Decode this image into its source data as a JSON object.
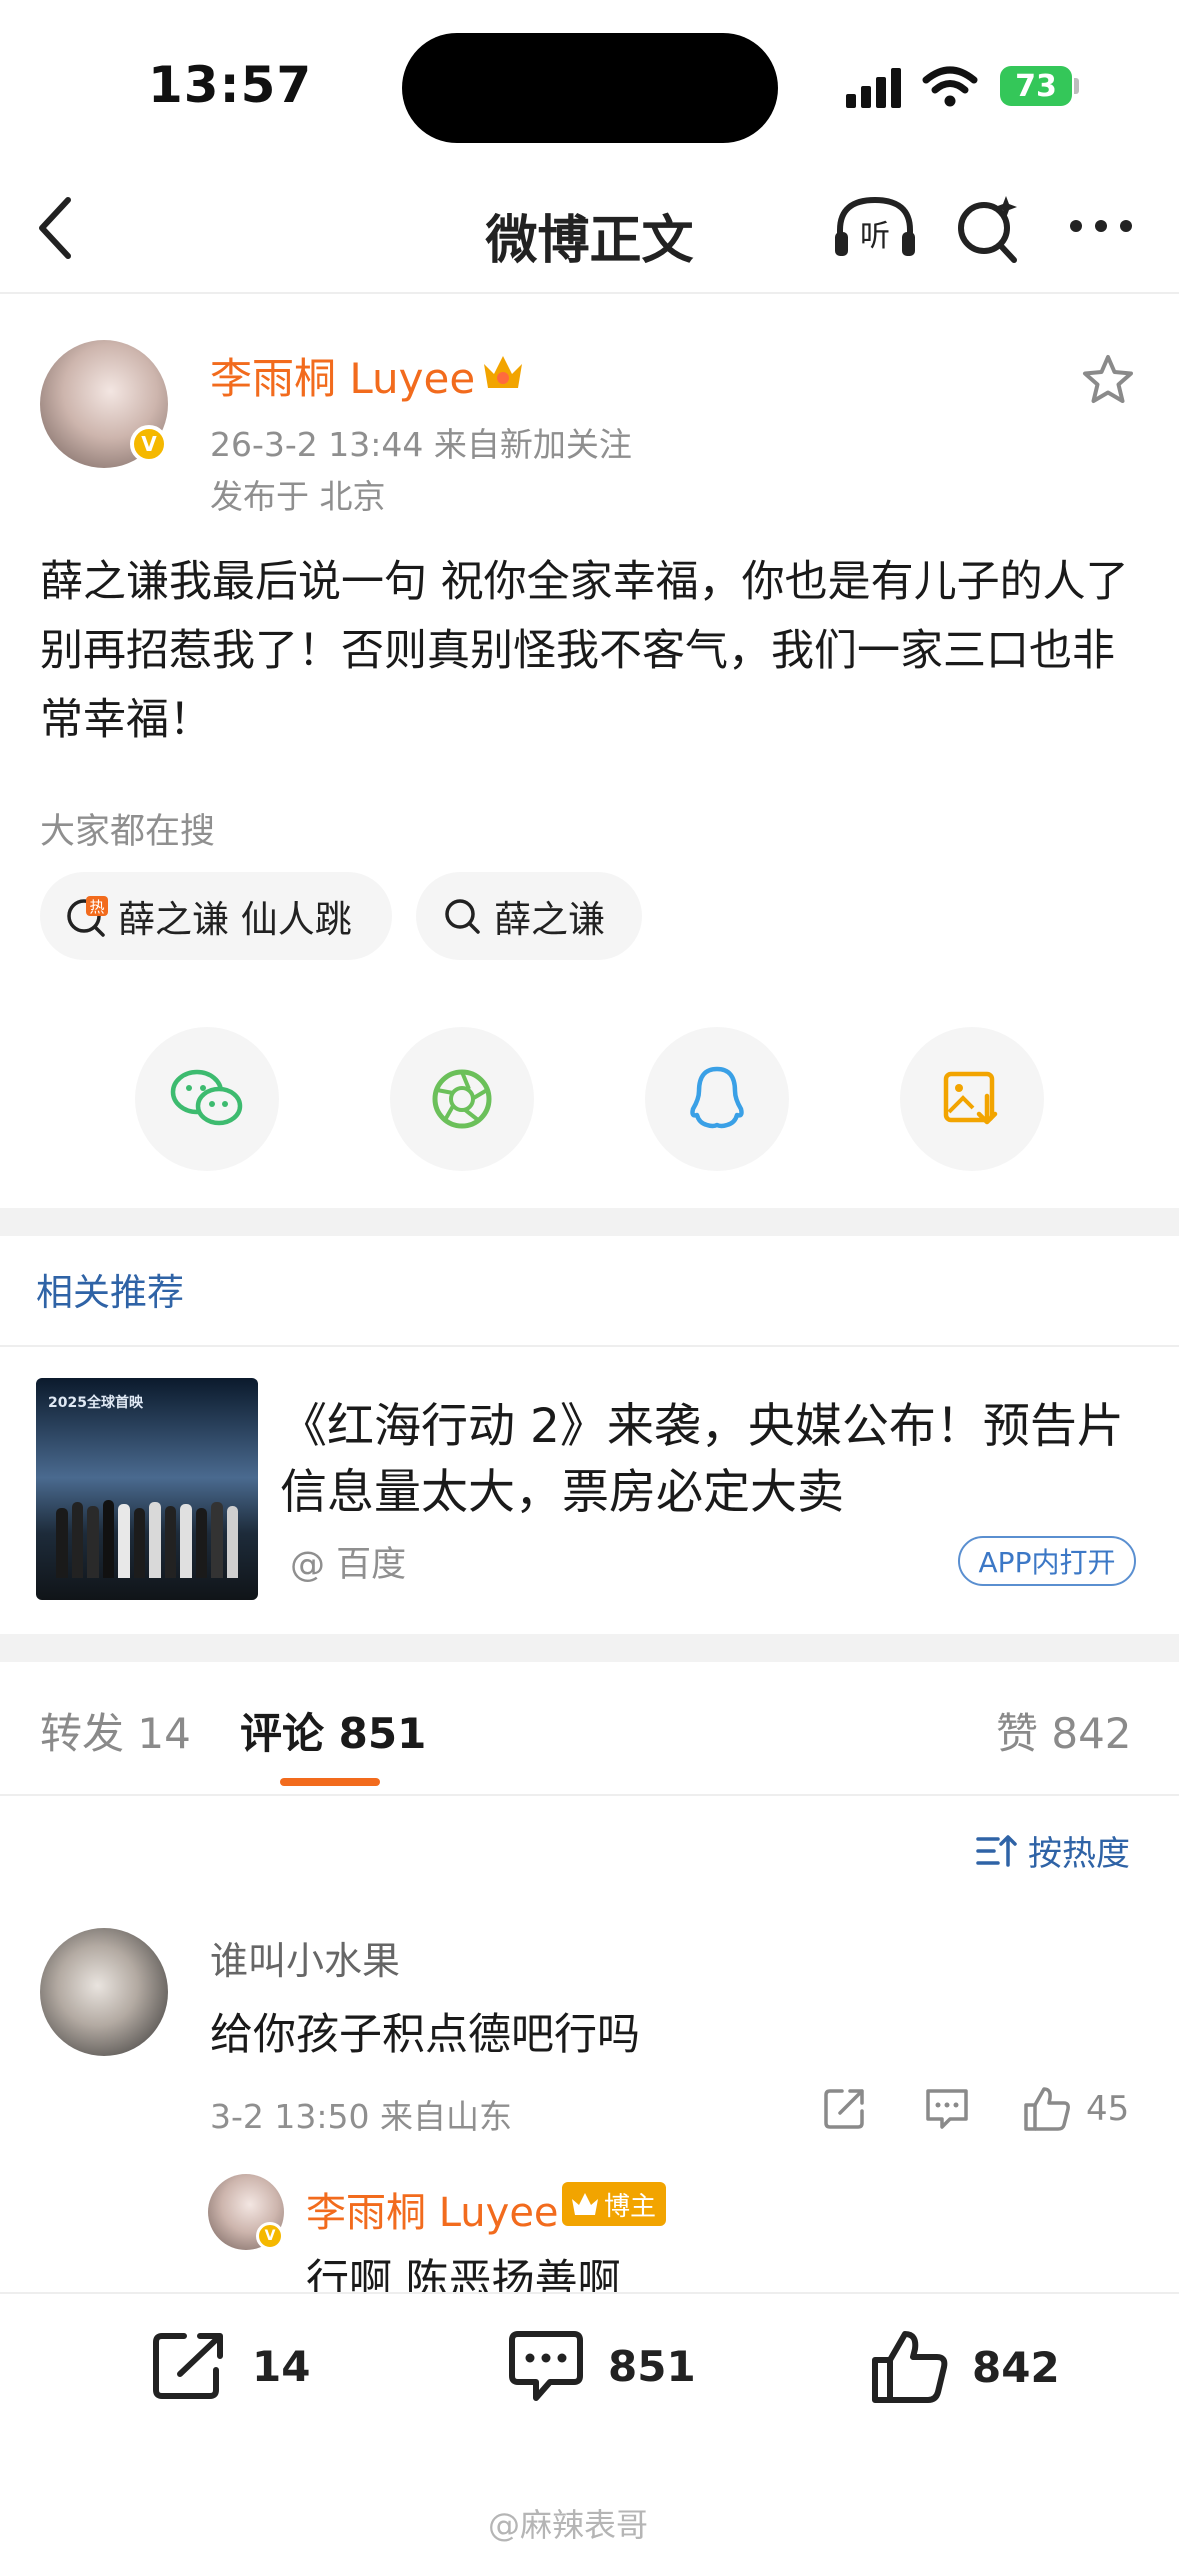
{
  "status_bar": {
    "time": "13:57",
    "battery": "73"
  },
  "header": {
    "title": "微博正文"
  },
  "post": {
    "author_name": "李雨桐 Luyee",
    "meta_line": "26-3-2 13:44  来自新加关注",
    "location": "发布于 北京",
    "text": "薛之谦我最后说一句 祝你全家幸福，你也是有儿子的人了别再招惹我了！否则真别怪我不客气，我们一家三口也非常幸福！",
    "hot_search_label": "大家都在搜",
    "hot_searches": [
      "薛之谦 仙人跳",
      "薛之谦"
    ]
  },
  "related": {
    "title": "相关推荐",
    "item_title": "《红海行动 2》来袭，央媒公布！预告片信息量太大，票房必定大卖",
    "source": "@ 百度",
    "open_button": "APP内打开",
    "thumb_caption": "2025全球首映"
  },
  "tabs": {
    "repost": "转发 14",
    "comment": "评论 851",
    "like": "赞 842"
  },
  "sort_label": "按热度",
  "comment": {
    "user": "谁叫小水果",
    "text": "给你孩子积点德吧行吗",
    "meta": "3-2 13:50  来自山东",
    "likes": "45",
    "reply": {
      "user": "李雨桐 Luyee",
      "badge": "博主",
      "text": "行啊 陈恶扬善啊"
    }
  },
  "bottom_bar": {
    "repost_count": "14",
    "comment_count": "851",
    "like_count": "842"
  },
  "watermark": "@麻辣表哥",
  "colors": {
    "accent_orange": "#f26b1d",
    "link_blue": "#2f63a6",
    "verified_gold": "#f5b800",
    "battery_green": "#34c759"
  }
}
